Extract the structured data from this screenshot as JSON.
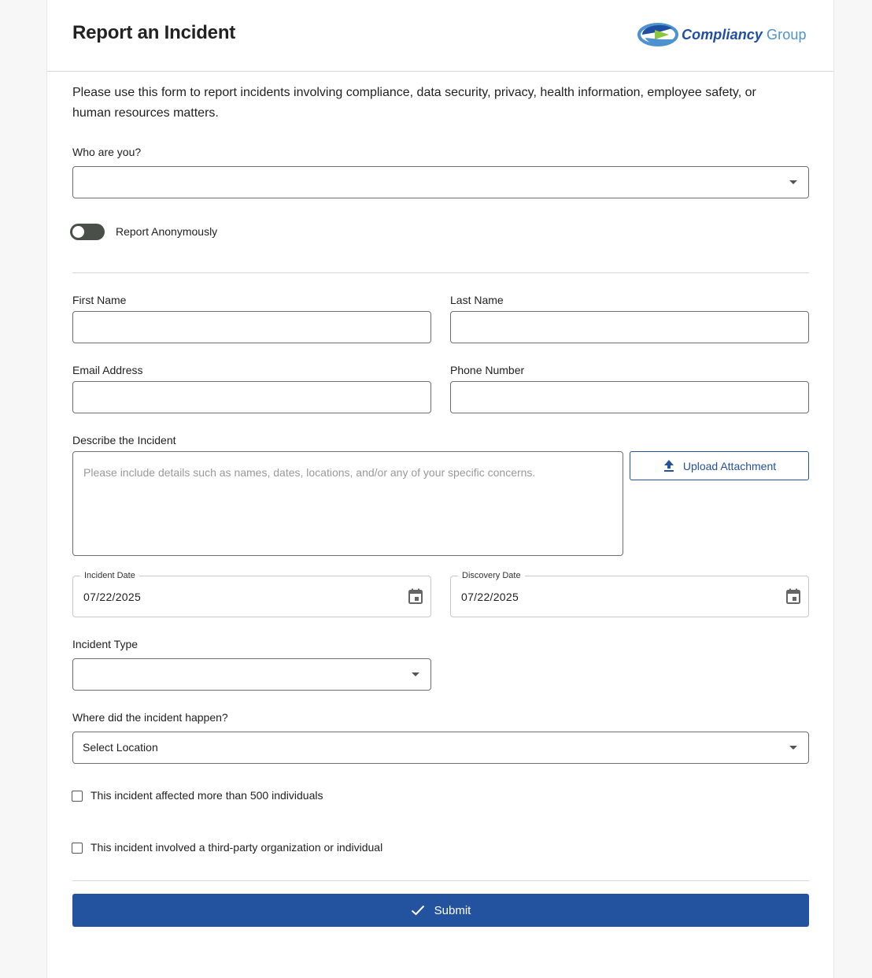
{
  "header": {
    "title": "Report an Incident",
    "logo": {
      "primary": "Compliancy",
      "secondary": "Group"
    }
  },
  "intro_text": "Please use this form to report incidents involving compliance, data security, privacy, health information, employee safety, or human resources matters.",
  "who_are_you": {
    "label": "Who are you?",
    "value": ""
  },
  "anonymous_toggle": {
    "label": "Report Anonymously",
    "checked": false
  },
  "first_name": {
    "label": "First Name",
    "value": ""
  },
  "last_name": {
    "label": "Last Name",
    "value": ""
  },
  "email": {
    "label": "Email Address",
    "value": ""
  },
  "phone": {
    "label": "Phone Number",
    "value": ""
  },
  "describe": {
    "label": "Describe the Incident",
    "placeholder": "Please include details such as names, dates, locations, and/or any of your specific concerns."
  },
  "upload": {
    "label": "Upload Attachment"
  },
  "incident_date": {
    "label": "Incident Date",
    "value": "07/22/2025"
  },
  "discovery_date": {
    "label": "Discovery Date",
    "value": "07/22/2025"
  },
  "incident_type": {
    "label": "Incident Type",
    "value": ""
  },
  "location": {
    "label": "Where did the incident happen?",
    "value": "Select Location"
  },
  "checkbox_500": {
    "label": "This incident affected more than 500 individuals",
    "checked": false
  },
  "checkbox_third_party": {
    "label": "This incident involved a third-party organization or individual",
    "checked": false
  },
  "submit": {
    "label": "Submit"
  },
  "colors": {
    "primary": "#23529e",
    "logo_light": "#4d93cf",
    "logo_green": "#8cc63f"
  }
}
